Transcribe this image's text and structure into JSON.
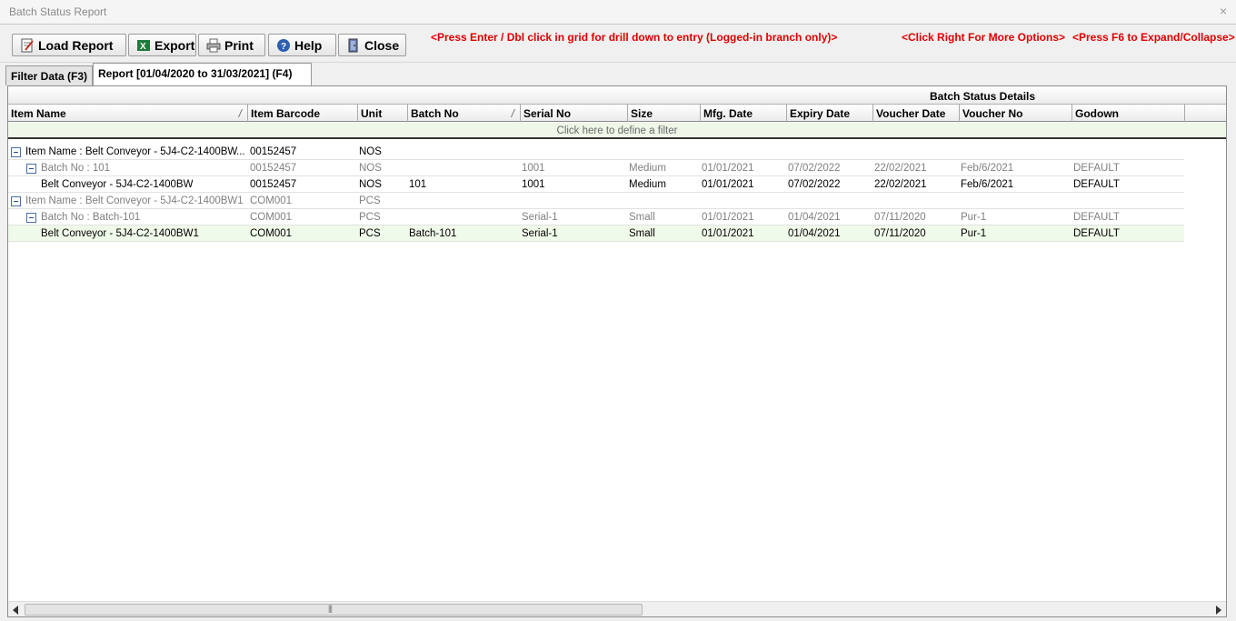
{
  "window": {
    "title": "Batch Status Report",
    "close_glyph": "×"
  },
  "toolbar": {
    "load": "Load Report",
    "export": "Export",
    "print": "Print",
    "help": "Help",
    "close": "Close",
    "hint_drill": "<Press Enter / Dbl click in grid for drill down to entry (Logged-in branch only)>",
    "hint_right": "<Click Right For More Options>",
    "hint_f6": "<Press F6 to Expand/Collapse>"
  },
  "tabs": {
    "filter": "Filter Data (F3)",
    "report": "Report [01/04/2020 to 31/03/2021] (F4)"
  },
  "grid": {
    "band_title": "Batch Status Details",
    "columns": {
      "item_name": "Item Name",
      "item_barcode": "Item Barcode",
      "unit": "Unit",
      "batch_no": "Batch No",
      "serial_no": "Serial No",
      "size": "Size",
      "mfg_date": "Mfg. Date",
      "expiry_date": "Expiry Date",
      "voucher_date": "Voucher Date",
      "voucher_no": "Voucher No",
      "godown": "Godown"
    },
    "filter_prompt": "Click here to define a filter",
    "rows": [
      {
        "name": "Item Name : Belt Conveyor - 5J4-C2-1400BW",
        "ellipsis": "...",
        "barcode": "00152457",
        "unit": "NOS",
        "batch": "",
        "serial": "",
        "size": "",
        "mfg": "",
        "expiry": "",
        "vdate": "",
        "vno": "",
        "godown": ""
      },
      {
        "name": "Batch No : 101",
        "barcode": "00152457",
        "unit": "NOS",
        "batch": "",
        "serial": "1001",
        "size": "Medium",
        "mfg": "01/01/2021",
        "expiry": "07/02/2022",
        "vdate": "22/02/2021",
        "vno": "Feb/6/2021",
        "godown": "DEFAULT"
      },
      {
        "name": "Belt Conveyor - 5J4-C2-1400BW",
        "barcode": "00152457",
        "unit": "NOS",
        "batch": "101",
        "serial": "1001",
        "size": "Medium",
        "mfg": "01/01/2021",
        "expiry": "07/02/2022",
        "vdate": "22/02/2021",
        "vno": "Feb/6/2021",
        "godown": "DEFAULT"
      },
      {
        "name": "Item Name : Belt Conveyor - 5J4-C2-1400BW1",
        "barcode": "COM001",
        "unit": "PCS",
        "batch": "",
        "serial": "",
        "size": "",
        "mfg": "",
        "expiry": "",
        "vdate": "",
        "vno": "",
        "godown": ""
      },
      {
        "name": "Batch No : Batch-101",
        "barcode": "COM001",
        "unit": "PCS",
        "batch": "",
        "serial": "Serial-1",
        "size": "Small",
        "mfg": "01/01/2021",
        "expiry": "01/04/2021",
        "vdate": "07/11/2020",
        "vno": "Pur-1",
        "godown": "DEFAULT"
      },
      {
        "name": "Belt Conveyor - 5J4-C2-1400BW1",
        "barcode": "COM001",
        "unit": "PCS",
        "batch": "Batch-101",
        "serial": "Serial-1",
        "size": "Small",
        "mfg": "01/01/2021",
        "expiry": "01/04/2021",
        "vdate": "07/11/2020",
        "vno": "Pur-1",
        "godown": "DEFAULT"
      }
    ]
  },
  "colors": {
    "hint_red": "#e00000",
    "selected_row": "#f0faea",
    "filter_row": "#eef7e8"
  },
  "icons": [
    "notepad-icon",
    "excel-icon",
    "printer-icon",
    "help-icon",
    "exit-door-icon",
    "collapse-icon",
    "scroll-left-icon",
    "scroll-right-icon"
  ]
}
